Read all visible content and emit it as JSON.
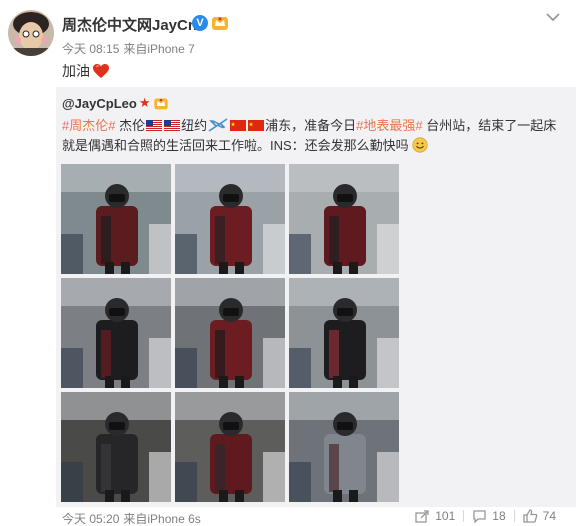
{
  "post": {
    "author": "周杰伦中文网JayCn",
    "time": "今天 08:15",
    "source": "来自iPhone 7",
    "text": "加油"
  },
  "repost": {
    "author": "@JayCpLeo",
    "segments": [
      {
        "type": "tag",
        "text": "#周杰伦#"
      },
      {
        "type": "text",
        "text": " 杰伦"
      },
      {
        "type": "icon",
        "icon": "us-flag"
      },
      {
        "type": "icon",
        "icon": "us-flag"
      },
      {
        "type": "text",
        "text": "纽约"
      },
      {
        "type": "icon",
        "icon": "airplane"
      },
      {
        "type": "icon",
        "icon": "cn-flag"
      },
      {
        "type": "icon",
        "icon": "cn-flag"
      },
      {
        "type": "text",
        "text": "浦东，准备今日"
      },
      {
        "type": "tag",
        "text": "#地表最强#"
      },
      {
        "type": "text",
        "text": " 台州站，结束了一起床就是偶遇和合照的生活回来工作啦。INS：还会发那么勤快吗"
      },
      {
        "type": "icon",
        "icon": "smile"
      }
    ],
    "photo_count": 9
  },
  "footer": {
    "time": "今天 05:20",
    "source": "来自iPhone 6s",
    "reposts": "101",
    "comments": "18",
    "likes": "74"
  },
  "colors": {
    "tag": "#eb7350",
    "repost_bg": "#f2f2f5",
    "meta": "#808080",
    "verified": "#2a8ae8"
  }
}
